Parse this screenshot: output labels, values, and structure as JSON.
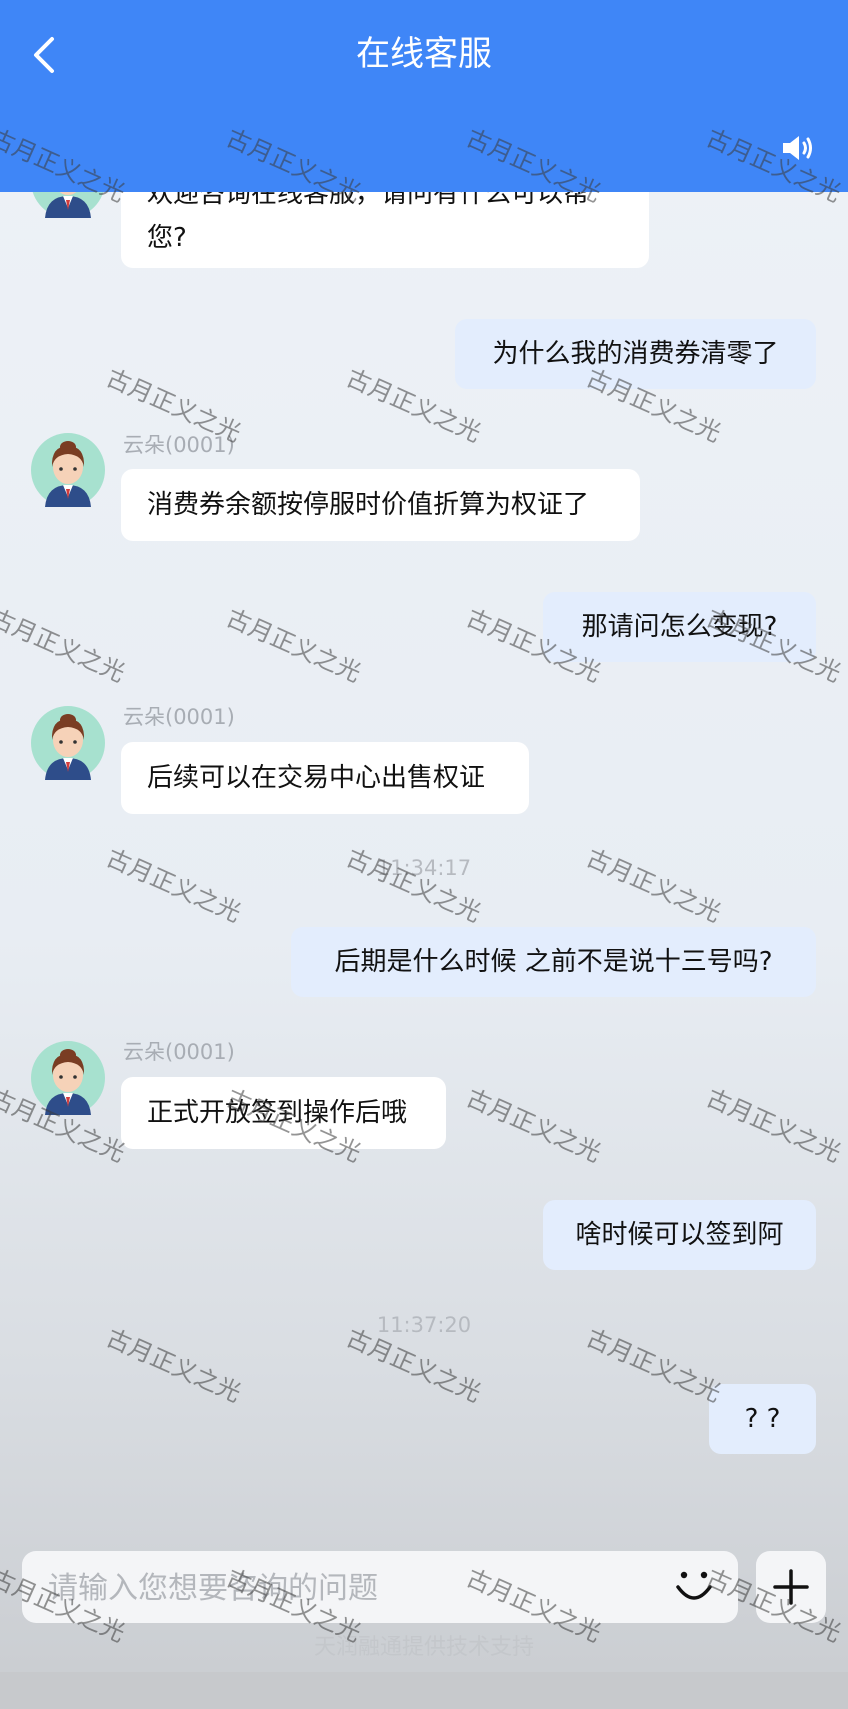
{
  "header": {
    "title": "在线客服",
    "back_icon": "chevron-left-icon",
    "sound_icon": "speaker-icon",
    "color": "#3f86f7"
  },
  "messages": {
    "m1_partial": [
      "欢迎咨询在线客服，请问有什么可以帮",
      "您?"
    ],
    "m2": "为什么我的消费券清零了",
    "m3_name": "云朵(0001)",
    "m3": "消费券余额按停服时价值折算为权证了",
    "m4": "那请问怎么变现?",
    "m5_name": "云朵(0001)",
    "m5": "后续可以在交易中心出售权证",
    "time1": "11:34:17",
    "m6": "后期是什么时候 之前不是说十三号吗?",
    "m7_name": "云朵(0001)",
    "m7": "正式开放签到操作后哦",
    "m8": "啥时候可以签到阿",
    "time2": "11:37:20",
    "m9": "? ?"
  },
  "input": {
    "placeholder": "请输入您想要咨询的问题",
    "emoji_icon": "smile-icon",
    "plus_icon": "plus-icon"
  },
  "footer": "天润融通提供技术支持",
  "watermark": "古月正义之光"
}
